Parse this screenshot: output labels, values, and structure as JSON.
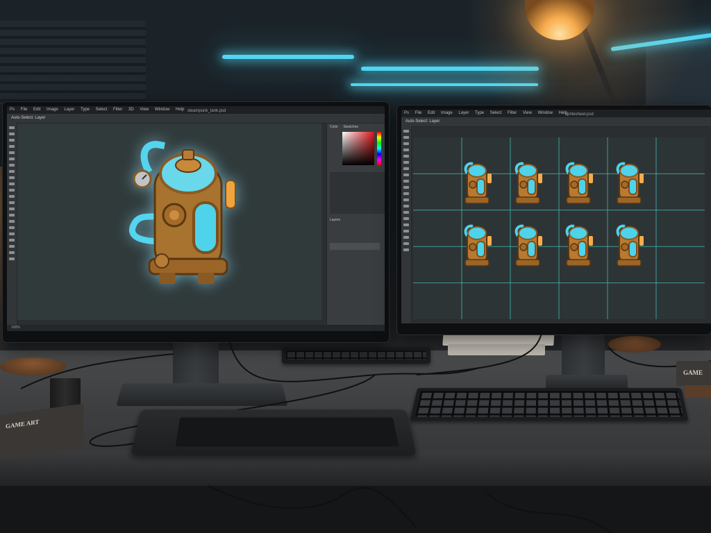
{
  "scene": {
    "description_tags": [
      "dual-monitor",
      "desk",
      "neon",
      "lamp"
    ],
    "left_screen": {
      "menu": [
        "Ps",
        "File",
        "Edit",
        "Image",
        "Layer",
        "Type",
        "Select",
        "Filter",
        "3D",
        "View",
        "Window",
        "Help"
      ],
      "doc_title": "steampunk_tank.psd",
      "options_text": "Auto-Select: Layer",
      "status_text": "100%",
      "panel_tabs": [
        "Color",
        "Swatches"
      ],
      "layers_tab": "Layers"
    },
    "right_screen": {
      "menu": [
        "Ps",
        "File",
        "Edit",
        "Image",
        "Layer",
        "Type",
        "Select",
        "Filter",
        "View",
        "Window",
        "Help"
      ],
      "doc_title": "spritesheet.psd",
      "options_text": "Auto-Select: Layer",
      "sprite_count": 8
    },
    "book_left_title": "GAME ART",
    "book_right_title": "GAME"
  },
  "colors": {
    "neon": "#52d6f2",
    "lamp": "#f7ac4c",
    "brass": "#b9792f",
    "glass": "#4fd3ea"
  }
}
